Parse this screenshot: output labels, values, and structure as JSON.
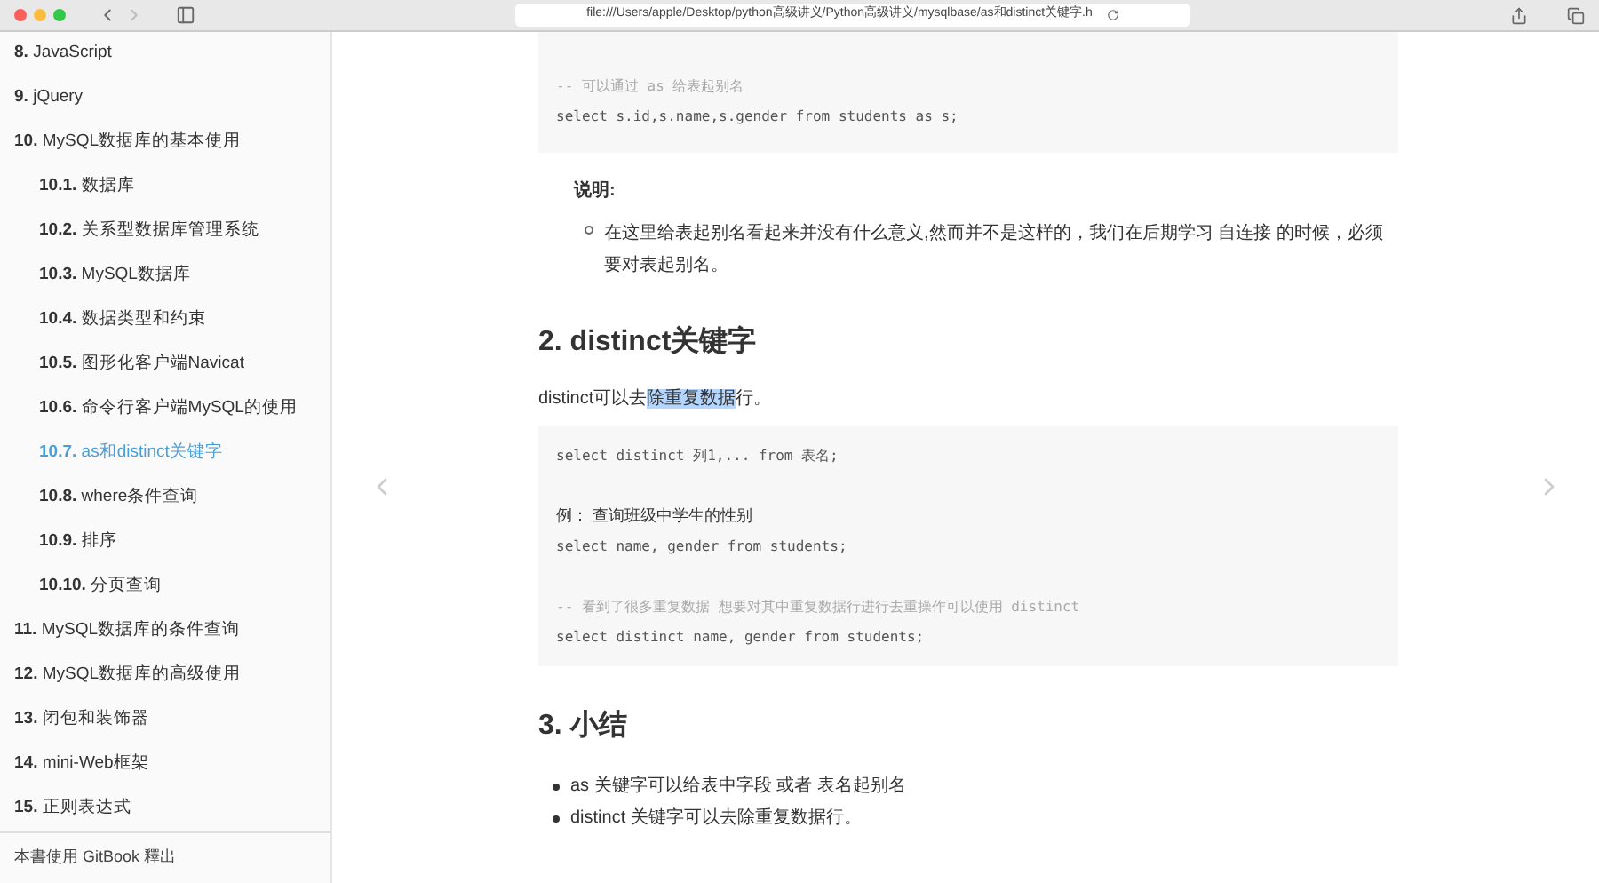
{
  "browser": {
    "url": "file:///Users/apple/Desktop/python高级讲义/Python高级讲义/mysqlbase/as和distinct关键字.h"
  },
  "sidebar": {
    "items": [
      {
        "num": "8.",
        "label": "JavaScript",
        "selected": false
      },
      {
        "num": "9.",
        "label": "jQuery",
        "selected": false
      },
      {
        "num": "10.",
        "label": "MySQL数据库的基本使用",
        "selected": false,
        "children": [
          {
            "num": "10.1.",
            "label": "数据库",
            "selected": false
          },
          {
            "num": "10.2.",
            "label": "关系型数据库管理系统",
            "selected": false
          },
          {
            "num": "10.3.",
            "label": "MySQL数据库",
            "selected": false
          },
          {
            "num": "10.4.",
            "label": "数据类型和约束",
            "selected": false
          },
          {
            "num": "10.5.",
            "label": "图形化客户端Navicat",
            "selected": false
          },
          {
            "num": "10.6.",
            "label": "命令行客户端MySQL的使用",
            "selected": false
          },
          {
            "num": "10.7.",
            "label": "as和distinct关键字",
            "selected": true
          },
          {
            "num": "10.8.",
            "label": "where条件查询",
            "selected": false
          },
          {
            "num": "10.9.",
            "label": "排序",
            "selected": false
          },
          {
            "num": "10.10.",
            "label": "分页查询",
            "selected": false
          }
        ]
      },
      {
        "num": "11.",
        "label": "MySQL数据库的条件查询",
        "selected": false
      },
      {
        "num": "12.",
        "label": "MySQL数据库的高级使用",
        "selected": false
      },
      {
        "num": "13.",
        "label": "闭包和装饰器",
        "selected": false
      },
      {
        "num": "14.",
        "label": "mini-Web框架",
        "selected": false
      },
      {
        "num": "15.",
        "label": "正则表达式",
        "selected": false
      }
    ],
    "footer": "本書使用 GitBook 釋出"
  },
  "content": {
    "code_top": [
      {
        "kind": "comment",
        "text": "-- 可以通过 as 给表起别名"
      },
      {
        "kind": "code",
        "text": "select s.id,s.name,s.gender from students as s;"
      }
    ],
    "note_label": "说明:",
    "note_items": [
      "在这里给表起别名看起来并没有什么意义,然而并不是这样的，我们在后期学习 自连接 的时候，必须要对表起别名。"
    ],
    "heading2": "2. distinct关键字",
    "paragraph": [
      {
        "text": "distinct可以去",
        "selected": false
      },
      {
        "text": "除重复数据",
        "selected": true
      },
      {
        "text": "行。",
        "selected": false
      }
    ],
    "code_main": [
      {
        "kind": "code",
        "text": "select distinct 列1,... from 表名;"
      },
      {
        "kind": "blank"
      },
      {
        "kind": "text",
        "text": "例： 查询班级中学生的性别"
      },
      {
        "kind": "code",
        "text": "select name, gender from students;"
      },
      {
        "kind": "blank"
      },
      {
        "kind": "comment",
        "text": "-- 看到了很多重复数据 想要对其中重复数据行进行去重操作可以使用 distinct"
      },
      {
        "kind": "code",
        "text": "select distinct name, gender from students;"
      }
    ],
    "heading3": "3. 小结",
    "summary": [
      "as 关键字可以给表中字段 或者 表名起别名",
      "distinct 关键字可以去除重复数据行。"
    ]
  }
}
